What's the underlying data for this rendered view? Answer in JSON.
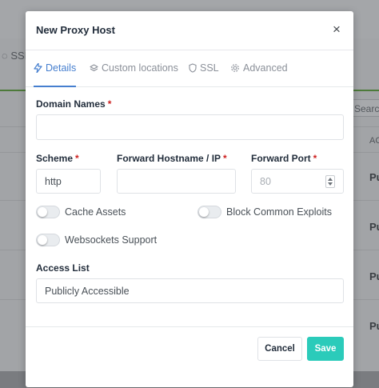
{
  "background": {
    "tab_partial": "SSL",
    "search_partial": "Search",
    "column_partial": "AC",
    "row_partial": "Pu"
  },
  "modal": {
    "title": "New Proxy Host",
    "close_glyph": "×",
    "tabs": [
      {
        "label": "Details",
        "icon": "lightning-icon",
        "active": true
      },
      {
        "label": "Custom locations",
        "icon": "layers-icon",
        "active": false
      },
      {
        "label": "SSL",
        "icon": "shield-icon",
        "active": false
      },
      {
        "label": "Advanced",
        "icon": "gear-icon",
        "active": false
      }
    ],
    "domain_names": {
      "label": "Domain Names",
      "required": "*",
      "value": ""
    },
    "scheme": {
      "label": "Scheme",
      "required": "*",
      "value": "http"
    },
    "forward_host": {
      "label": "Forward Hostname / IP",
      "required": "*",
      "value": ""
    },
    "forward_port": {
      "label": "Forward Port",
      "required": "*",
      "placeholder": "80"
    },
    "toggles": {
      "cache_assets": {
        "label": "Cache Assets",
        "on": false
      },
      "block_exploits": {
        "label": "Block Common Exploits",
        "on": false
      },
      "websockets": {
        "label": "Websockets Support",
        "on": false
      }
    },
    "access_list": {
      "label": "Access List",
      "value": "Publicly Accessible"
    },
    "buttons": {
      "cancel": "Cancel",
      "save": "Save"
    }
  },
  "colors": {
    "accent": "#467fcf",
    "save": "#2bcbba",
    "required": "#cd201f"
  }
}
